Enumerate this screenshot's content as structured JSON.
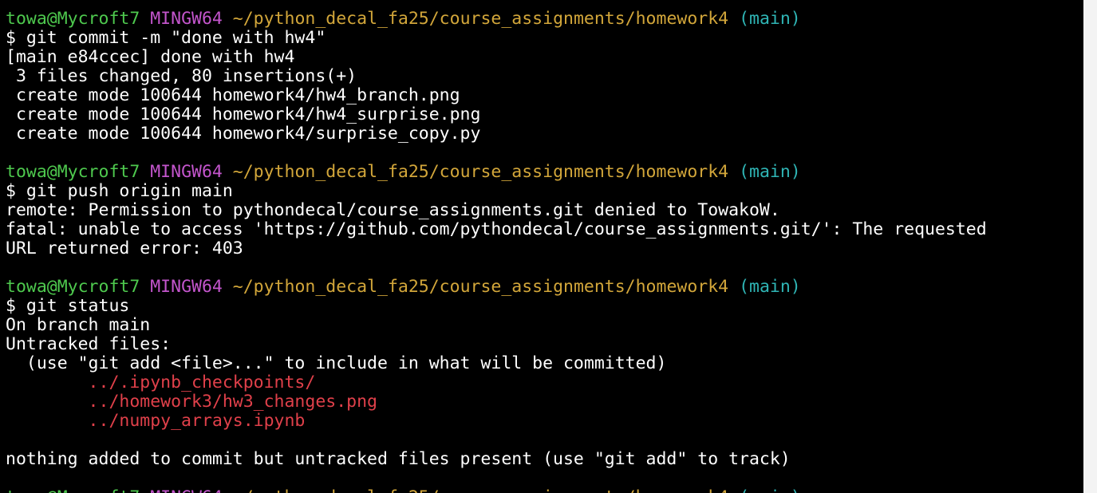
{
  "colors": {
    "background": "#000000",
    "text": "#ffffff",
    "user_host": "#4ec94e",
    "system": "#c355cc",
    "path": "#d2a63a",
    "branch": "#2fb5b5",
    "untracked": "#e0404a"
  },
  "prompt": {
    "user_host": "towa@Mycroft7",
    "system": "MINGW64",
    "path": "~/python_decal_fa25/course_assignments/homework4",
    "branch": "(main)"
  },
  "blocks": [
    {
      "command": "$ git commit -m \"done with hw4\"",
      "output": [
        "[main e84ccec] done with hw4",
        " 3 files changed, 80 insertions(+)",
        " create mode 100644 homework4/hw4_branch.png",
        " create mode 100644 homework4/hw4_surprise.png",
        " create mode 100644 homework4/surprise_copy.py"
      ]
    },
    {
      "command": "$ git push origin main",
      "output": [
        "remote: Permission to pythondecal/course_assignments.git denied to TowakoW.",
        "fatal: unable to access 'https://github.com/pythondecal/course_assignments.git/': The requested",
        "URL returned error: 403"
      ]
    },
    {
      "command": "$ git status",
      "output": [
        "On branch main",
        "Untracked files:",
        "  (use \"git add <file>...\" to include in what will be committed)"
      ],
      "untracked_files": [
        "        ../.ipynb_checkpoints/",
        "        ../homework3/hw3_changes.png",
        "        ../numpy_arrays.ipynb"
      ],
      "footer": "nothing added to commit but untracked files present (use \"git add\" to track)"
    }
  ]
}
